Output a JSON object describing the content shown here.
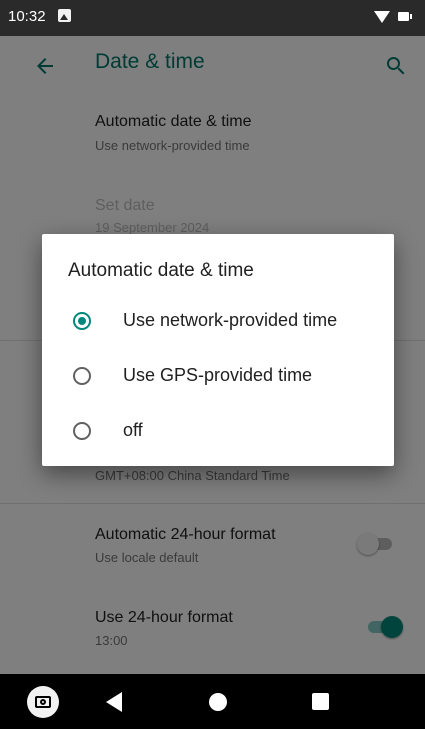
{
  "status_bar": {
    "time": "10:32",
    "icons": [
      "image-icon",
      "wifi-icon",
      "battery-icon"
    ]
  },
  "app_bar": {
    "title": "Date & time",
    "back_icon": "arrow-left-icon",
    "search_icon": "search-icon"
  },
  "settings": {
    "automatic_date_time": {
      "title": "Automatic date & time",
      "summary": "Use network-provided time"
    },
    "set_date": {
      "title": "Set date",
      "summary": "19 September 2024"
    },
    "time_zone": {
      "summary": "GMT+08:00 China Standard Time"
    },
    "automatic_24_hour": {
      "title": "Automatic 24-hour format",
      "summary": "Use locale default",
      "enabled": false
    },
    "use_24_hour": {
      "title": "Use 24-hour format",
      "summary": "13:00",
      "enabled": true
    }
  },
  "dialog": {
    "title": "Automatic date & time",
    "options": [
      {
        "label": "Use network-provided time",
        "selected": true
      },
      {
        "label": "Use GPS-provided time",
        "selected": false
      },
      {
        "label": "off",
        "selected": false
      }
    ]
  },
  "nav_bar": {
    "buttons": [
      "camera-icon",
      "back-icon",
      "home-icon",
      "recents-icon"
    ]
  },
  "colors": {
    "accent": "#00897b",
    "title": "#00796b",
    "scrim": "rgba(0,0,0,0.5)"
  }
}
